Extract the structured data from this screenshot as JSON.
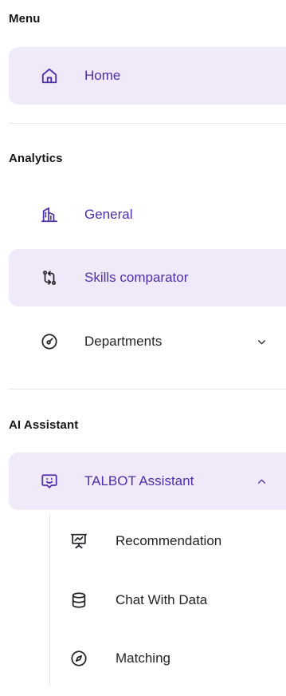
{
  "sections": {
    "menu": {
      "title": "Menu"
    },
    "analytics": {
      "title": "Analytics"
    },
    "ai": {
      "title": "AI Assistant"
    }
  },
  "menu_items": {
    "home": {
      "label": "Home",
      "icon": "home-icon"
    }
  },
  "analytics_items": {
    "general": {
      "label": "General",
      "icon": "building-icon"
    },
    "skills": {
      "label": "Skills comparator",
      "icon": "compare-arrows-icon"
    },
    "departments": {
      "label": "Departments",
      "icon": "gauge-icon"
    }
  },
  "ai_items": {
    "talbot": {
      "label": "TALBOT Assistant",
      "icon": "chat-smile-icon"
    },
    "children": {
      "recommendation": {
        "label": "Recommendation",
        "icon": "presentation-chart-icon"
      },
      "chat": {
        "label": "Chat With Data",
        "icon": "database-icon"
      },
      "matching": {
        "label": "Matching",
        "icon": "compass-icon"
      }
    }
  },
  "colors": {
    "accent": "#4f2da6",
    "selected_bg": "#efe9f9",
    "divider": "#e6e6ea"
  }
}
